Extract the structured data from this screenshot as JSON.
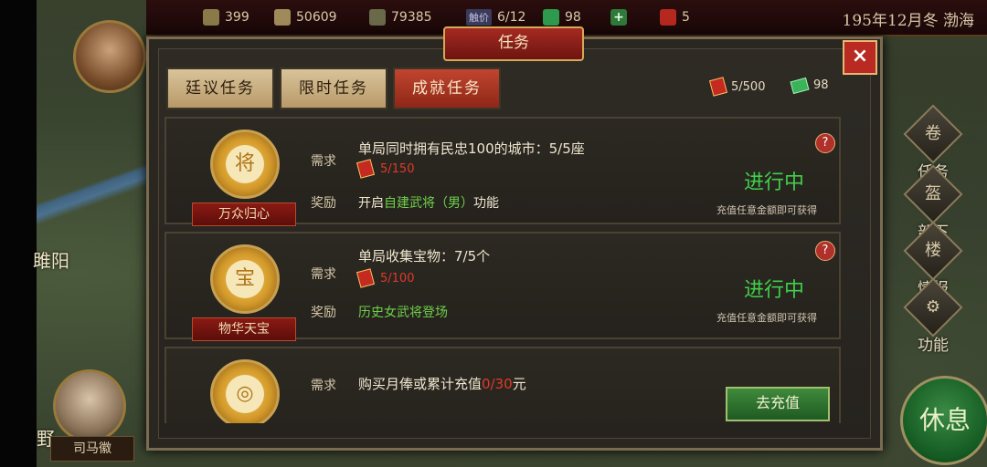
{
  "topbar": {
    "resources": [
      {
        "icon": "food-icon",
        "value": "399"
      },
      {
        "icon": "gold-icon",
        "value": "50609"
      },
      {
        "icon": "troops-icon",
        "value": "79385"
      },
      {
        "icon": "official-icon",
        "value": "6/12"
      },
      {
        "icon": "green-ticket-icon",
        "value": "98"
      },
      {
        "icon": "plus-icon",
        "value": ""
      },
      {
        "icon": "red-ticket-icon",
        "value": "5"
      }
    ],
    "official_label": "触价",
    "season": "195年12月冬 渤海"
  },
  "map": {
    "city": "雎阳",
    "label_ye": "野"
  },
  "advisor": {
    "name": "司马徽"
  },
  "dialog": {
    "title": "任务",
    "close": "×",
    "tabs": [
      "廷议任务",
      "限时任务",
      "成就任务"
    ],
    "currency_red": "5/500",
    "currency_green": "98"
  },
  "tasks": [
    {
      "badge_name": "万众归心",
      "req_label": "需求",
      "req_text": "单局同时拥有民忠100的城市：5/5座",
      "progress": "5/150",
      "reward_label": "奖励",
      "reward_prefix": "开启",
      "reward_highlight": "自建武将（男）",
      "reward_suffix": "功能",
      "status": "进行中",
      "hint": "充值任意金额即可获得",
      "help": "?"
    },
    {
      "badge_name": "物华天宝",
      "req_label": "需求",
      "req_text": "单局收集宝物：7/5个",
      "progress": "5/100",
      "reward_label": "奖励",
      "reward_highlight": "历史女武将登场",
      "status": "进行中",
      "hint": "充值任意金额即可获得",
      "help": "?"
    },
    {
      "req_label": "需求",
      "req_prefix": "购买月俸或累计充值",
      "req_highlight": "0/30",
      "req_suffix": "元",
      "button": "去充值"
    }
  ],
  "sidemenu": [
    "任务",
    "部下",
    "情报",
    "功能"
  ],
  "rest_button": "休息",
  "colors": {
    "accent_red": "#a52a22",
    "status_green": "#3fcf4a",
    "gold": "#d4aa55"
  }
}
